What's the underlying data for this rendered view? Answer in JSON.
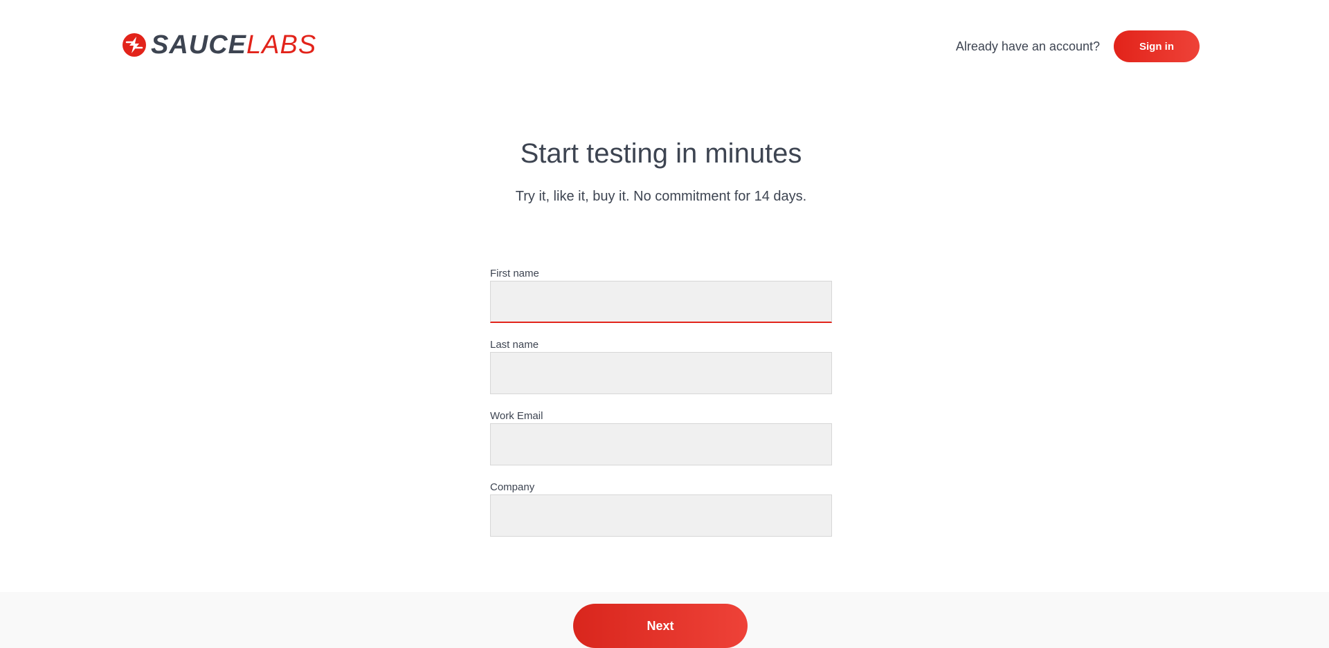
{
  "header": {
    "logo": {
      "part1": "SAUCE",
      "part2": "LABS",
      "icon": "saucelabs-bolt-icon"
    },
    "account_prompt": "Already have an account?",
    "signin_label": "Sign in"
  },
  "main": {
    "title": "Start testing in minutes",
    "subtitle": "Try it, like it, buy it. No commitment for 14 days."
  },
  "form": {
    "fields": [
      {
        "label": "First name",
        "value": ""
      },
      {
        "label": "Last name",
        "value": ""
      },
      {
        "label": "Work Email",
        "value": ""
      },
      {
        "label": "Company",
        "value": ""
      }
    ],
    "next_label": "Next"
  },
  "colors": {
    "brand_red": "#e2231a",
    "text_dark": "#3d4451",
    "input_bg": "#f0f0f0"
  }
}
